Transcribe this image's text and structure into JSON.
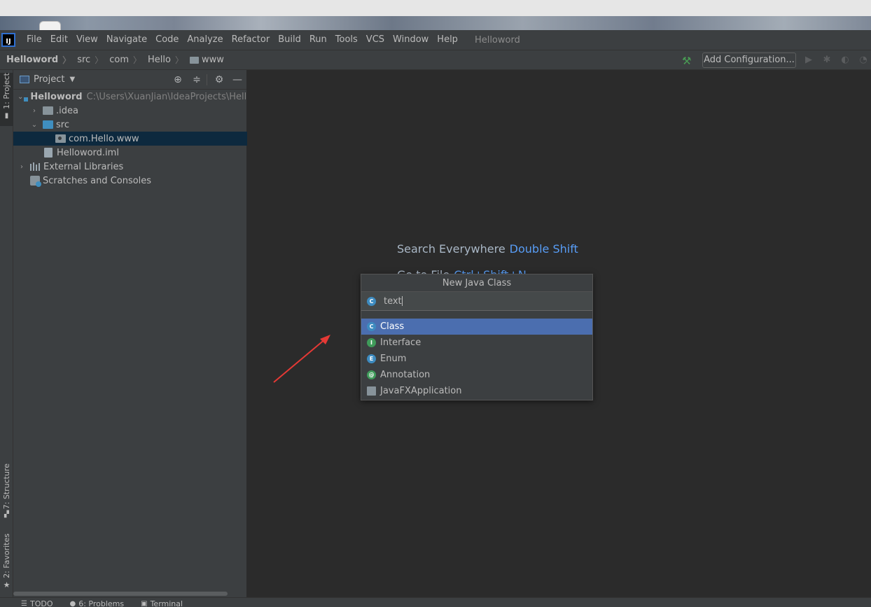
{
  "menubar": {
    "items": [
      "File",
      "Edit",
      "View",
      "Navigate",
      "Code",
      "Analyze",
      "Refactor",
      "Build",
      "Run",
      "Tools",
      "VCS",
      "Window",
      "Help"
    ],
    "project_name": "Helloword"
  },
  "navbar": {
    "crumbs": [
      "Helloword",
      "src",
      "com",
      "Hello",
      "www"
    ],
    "add_configuration": "Add Configuration..."
  },
  "left_strip": {
    "tabs": [
      "1: Project",
      "7: Structure",
      "2: Favorites"
    ]
  },
  "project_panel": {
    "title": "Project",
    "tree": [
      {
        "label": "Helloword",
        "path": "C:\\Users\\XuanJian\\IdeaProjects\\Hellow"
      },
      {
        "label": ".idea"
      },
      {
        "label": "src"
      },
      {
        "label": "com.Hello.www"
      },
      {
        "label": "Helloword.iml"
      },
      {
        "label": "External Libraries"
      },
      {
        "label": "Scratches and Consoles"
      }
    ]
  },
  "editor": {
    "hint_search": {
      "label": "Search Everywhere",
      "key": "Double Shift"
    },
    "hint_goto": {
      "label": "Go to File",
      "key": "Ctrl+Shift+N"
    }
  },
  "new_class_popup": {
    "title": "New Java Class",
    "input_value": "text",
    "options": [
      "Class",
      "Interface",
      "Enum",
      "Annotation",
      "JavaFXApplication"
    ],
    "selected": "Class"
  },
  "bottom_strip": {
    "tabs": [
      "TODO",
      "6: Problems",
      "Terminal"
    ]
  },
  "colors": {
    "accent_blue": "#589df6",
    "selection": "#4b6eaf",
    "annotation_arrow": "#e53935"
  }
}
